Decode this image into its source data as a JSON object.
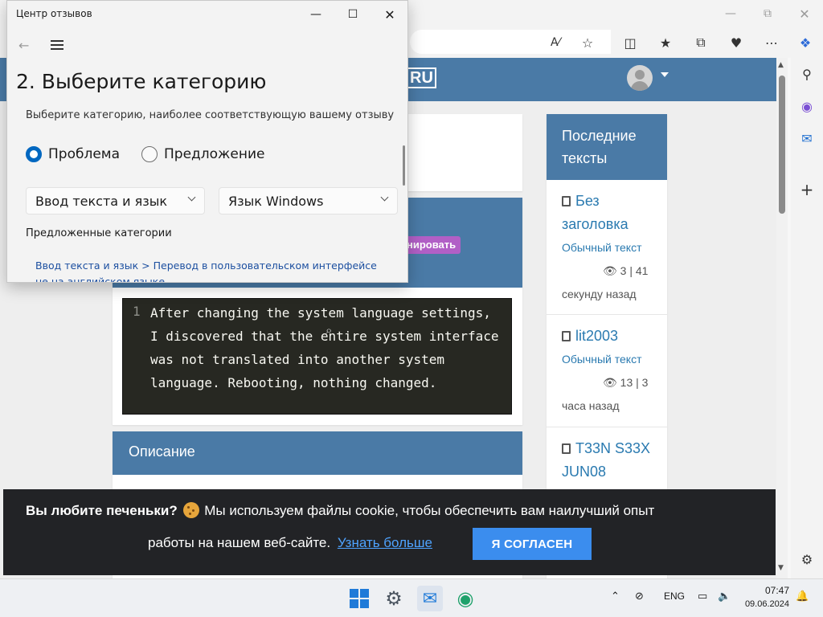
{
  "feedback_window": {
    "title": "Центр отзывов",
    "heading": "2. Выберите категорию",
    "subtitle": "Выберите категорию, наиболее соответствующую вашему отзыву",
    "radio_problem": "Проблема",
    "radio_suggestion": "Предложение",
    "selected_type": "Проблема",
    "category_select": "Ввод текста и язык",
    "subcategory_select": "Язык Windows",
    "suggested_label": "Предложенные категории",
    "suggested_link": "Ввод текста и язык > Перевод в пользовательском интерфейсе не на английском языке"
  },
  "site": {
    "logo": "RU",
    "tag_badge": "нировать",
    "code_line_number": "1",
    "code_text": "After changing the system language settings, I discovered that the entire system interface was not translated into another system language. Rebooting, nothing changed.",
    "description_title": "Описание",
    "latest_title": "Последние тексты",
    "latest": [
      {
        "title": "Без заголовка",
        "type": "Обычный текст",
        "views": "3",
        "count": "41",
        "time": "секунду назад",
        "meta_views": "👁 3 | 41",
        "meta_time": "секунд назад"
      },
      {
        "title": "lit2003",
        "type": "Обычный текст",
        "views": "13",
        "count": "3",
        "meta_views": "👁 13 | 3",
        "meta_time": "часа назад"
      },
      {
        "title": "T33N S33X JUN08"
      }
    ]
  },
  "cookie": {
    "bold": "Вы любите печеньки?",
    "text": "Мы используем файлы cookie, чтобы обеспечить вам наилучший опыт",
    "text2": "работы на нашем веб-сайте.",
    "link": "Узнать больше",
    "accept": "Я СОГЛАСЕН"
  },
  "taskbar": {
    "language": "ENG",
    "time": "07:47",
    "date": "09.06.2024"
  },
  "colors": {
    "site_header": "#4a7aa6",
    "accent": "#0067c0",
    "cookie_button": "#3b8dee",
    "badge": "#b15fc6"
  }
}
